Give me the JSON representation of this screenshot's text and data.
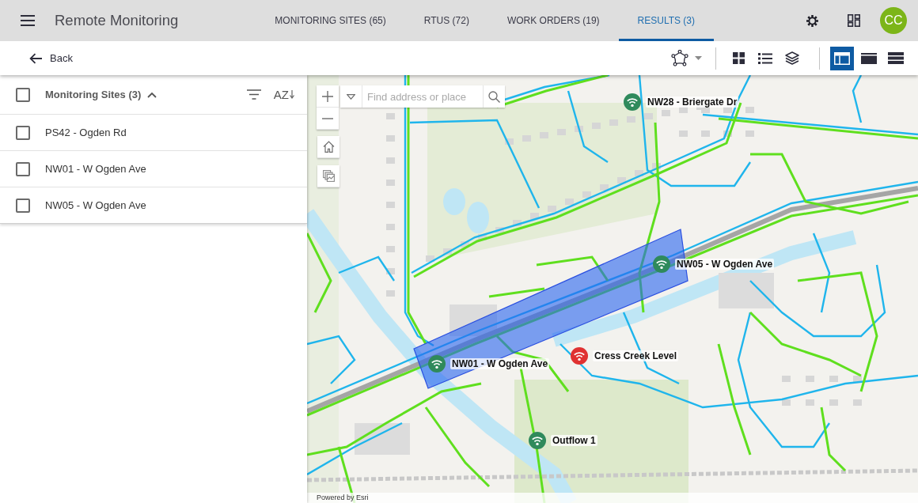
{
  "app_bar": {
    "title": "Remote Monitoring",
    "tabs": [
      {
        "label": "MONITORING SITES (65)",
        "selected": false
      },
      {
        "label": "RTUS (72)",
        "selected": false
      },
      {
        "label": "WORK ORDERS (19)",
        "selected": false
      },
      {
        "label": "RESULTS (3)",
        "selected": true
      }
    ],
    "avatar": "CC"
  },
  "toolbar": {
    "back": "Back",
    "layouts": [
      {
        "selected": true
      },
      {
        "selected": false
      },
      {
        "selected": false
      }
    ]
  },
  "site_list": {
    "title": "Monitoring Sites (3)",
    "checked": false,
    "expanded": true,
    "sort_label": "AZ",
    "items": [
      {
        "name": "PS42 - Ogden Rd",
        "checked": false
      },
      {
        "name": "NW01 - W Ogden Ave",
        "checked": false
      },
      {
        "name": "NW05 - W Ogden Ave",
        "checked": false
      }
    ]
  },
  "map": {
    "search": {
      "placeholder": "Find address or place"
    },
    "markers": [
      {
        "label": "NW28 - Briergate Dr",
        "color": "#2f8a5c"
      },
      {
        "label": "NW05 - W Ogden Ave",
        "color": "#2f8a5c"
      },
      {
        "label": "NW01 - W Ogden Ave",
        "color": "#2f8a5c"
      },
      {
        "label": "Cress Creek Level",
        "color": "#e03131"
      },
      {
        "label": "Outflow 1",
        "color": "#2f8a5c"
      }
    ],
    "attribution": "Powered by Esri"
  }
}
